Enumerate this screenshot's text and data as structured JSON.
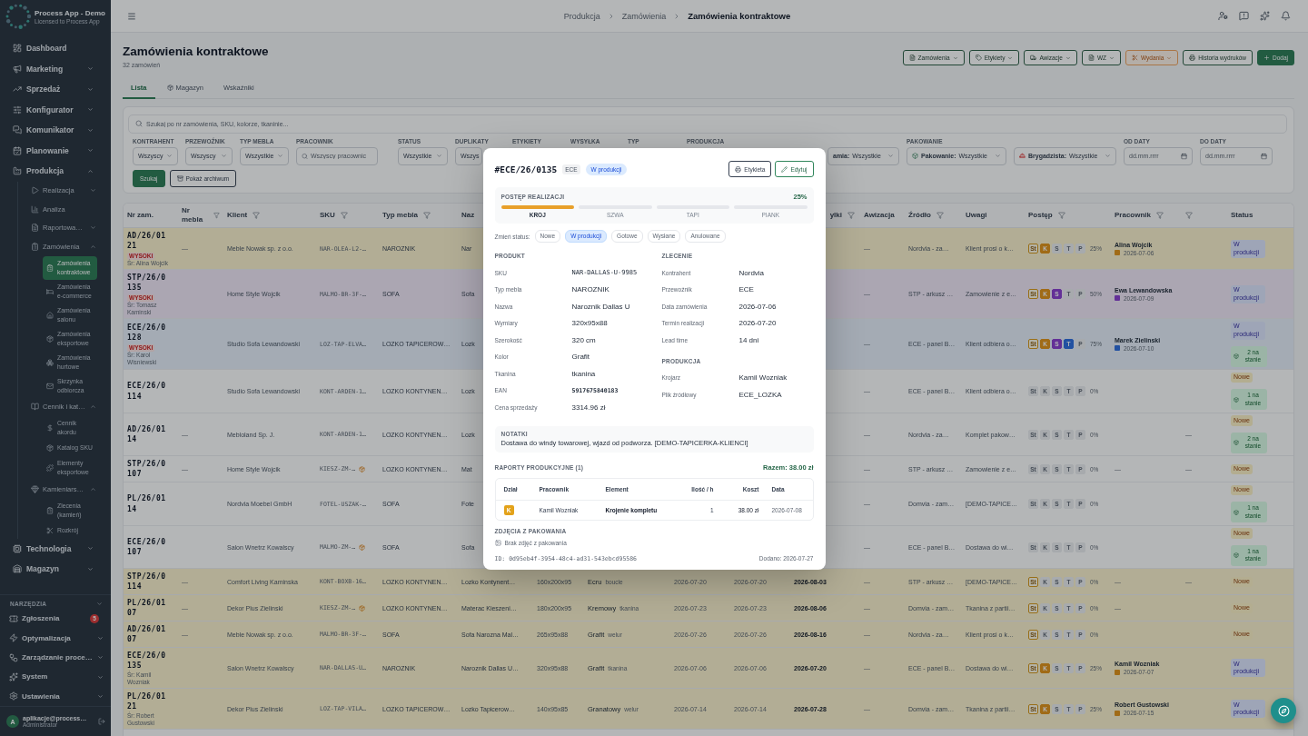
{
  "sidebar": {
    "app_name": "Process App - Demo",
    "app_subtitle": "Licensed to Process App",
    "items": [
      {
        "label": "Dashboard",
        "selected": false
      },
      {
        "label": "Marketing",
        "expanded": false
      },
      {
        "label": "Sprzedaż",
        "expanded": false
      },
      {
        "label": "Konfigurator",
        "expanded": false
      },
      {
        "label": "Komunikator",
        "expanded": false
      },
      {
        "label": "Planowanie",
        "expanded": false
      },
      {
        "label": "Produkcja",
        "expanded": true,
        "children": [
          {
            "label": "Realizacja",
            "expanded": false
          },
          {
            "label": "Analiza",
            "selected": false
          },
          {
            "label": "Raportowa…",
            "expanded": false
          },
          {
            "label": "Zamówienia",
            "expanded": true,
            "children": [
              {
                "label": "Zamówienia kontraktowe",
                "selected": true
              },
              {
                "label": "Zamówienia e-commerce",
                "selected": false
              },
              {
                "label": "Zamówienia salonu",
                "selected": false
              },
              {
                "label": "Zamówienia eksportowe",
                "selected": false
              },
              {
                "label": "Zamówienia hurtowe",
                "selected": false
              },
              {
                "label": "Skrzynka odbiorcza",
                "selected": false
              }
            ]
          },
          {
            "label": "Cennik i kat…",
            "expanded": true,
            "children": [
              {
                "label": "Cennik akordu",
                "selected": false
              },
              {
                "label": "Katalog SKU",
                "selected": false
              },
              {
                "label": "Elementy eksportowe",
                "selected": false
              }
            ]
          },
          {
            "label": "Kamieniars…",
            "expanded": true,
            "children": [
              {
                "label": "Zlecenia (kamień)",
                "selected": false
              },
              {
                "label": "Rozkrój",
                "selected": false
              }
            ]
          }
        ]
      },
      {
        "label": "Technologia",
        "expanded": false
      },
      {
        "label": "Magazyn",
        "expanded": false
      }
    ],
    "tools": {
      "label": "NARZĘDZIA",
      "expanded": true,
      "items": [
        {
          "label": "Zgłoszenia",
          "selected": false,
          "badge": "5"
        },
        {
          "label": "Optymalizacja",
          "expanded": false
        },
        {
          "label": "Zarządzanie proce…",
          "expanded": false
        },
        {
          "label": "System",
          "expanded": false
        },
        {
          "label": "Ustawienia",
          "expanded": false
        }
      ]
    },
    "user": {
      "initial": "A",
      "email": "aplikacje@process…",
      "role": "Administrator"
    }
  },
  "header": {
    "breadcrumb": [
      "Produkcja",
      "Zamówienia",
      "Zamówienia kontraktowe"
    ]
  },
  "page": {
    "title": "Zamówienia kontraktowe",
    "subtitle": "32 zamówień",
    "actions": [
      {
        "label": "Zamówienia",
        "kind": "outline",
        "menu": true
      },
      {
        "label": "Etykiety",
        "kind": "outline",
        "menu": true
      },
      {
        "label": "Awizacje",
        "kind": "outline",
        "menu": true
      },
      {
        "label": "WZ",
        "kind": "outline",
        "menu": true
      },
      {
        "label": "Wydania",
        "kind": "warning",
        "menu": true
      },
      {
        "label": "Historia wydruków",
        "kind": "outline"
      },
      {
        "label": "Dodaj",
        "kind": "primary"
      }
    ],
    "tabs": [
      {
        "label": "Lista",
        "selected": true
      },
      {
        "label": "Magazyn",
        "selected": false
      },
      {
        "label": "Wskaźniki",
        "selected": false
      }
    ]
  },
  "filters": {
    "search": {
      "placeholder": "Szukaj po nr zamówienia, SKU, kolorze, tkaninie..."
    },
    "fields": [
      {
        "label": "KONTRAHENT",
        "kind": "select",
        "value": "Wszyscy"
      },
      {
        "label": "PRZEWOŹNIK",
        "kind": "select",
        "value": "Wszyscy"
      },
      {
        "label": "TYP MEBLA",
        "kind": "select",
        "value": "Wszystkie"
      },
      {
        "label": "PRACOWNIK",
        "kind": "search",
        "placeholder": "Wszyscy pracownic"
      },
      {
        "label": "STATUS",
        "kind": "select",
        "value": "Wszystkie"
      },
      {
        "label": "DUPLIKATY",
        "kind": "select",
        "value": "Wszys"
      },
      {
        "label": "ETYKIETY",
        "kind": "covered"
      },
      {
        "label": "WYSYŁKA",
        "kind": "covered"
      },
      {
        "label": "TYP",
        "kind": "covered"
      },
      {
        "label": "PRODUKCJA",
        "kind": "covered"
      },
      {
        "kind": "select",
        "prefix": "amia:",
        "value": "Wszystkie"
      },
      {
        "label": "PAKOWANIE",
        "kind": "select",
        "prefix": "Pakowanie:",
        "value": "Wszystkie"
      },
      {
        "kind": "select",
        "prefix": "Brygadzista:",
        "value": "Wszystkie"
      },
      {
        "label": "OD DATY",
        "kind": "date",
        "placeholder": "dd.mm.rrrr"
      },
      {
        "label": "DO DATY",
        "kind": "date",
        "placeholder": "dd.mm.rrrr"
      }
    ],
    "buttons": [
      {
        "label": "Szukaj",
        "kind": "primary"
      },
      {
        "label": "Pokaż archiwum",
        "kind": "outline"
      }
    ]
  },
  "table": {
    "columns": [
      {
        "label": "Nr zam."
      },
      {
        "label": "Nr mebla",
        "filter": true
      },
      {
        "label": "Klient",
        "filter": true
      },
      {
        "label": "SKU",
        "filter": true
      },
      {
        "label": "Typ mebla",
        "filter": true
      },
      {
        "label": "Naz"
      },
      {
        "label": "ylki",
        "filter": true
      },
      {
        "label": "Awizacja"
      },
      {
        "label": "Źródło",
        "filter": true
      },
      {
        "label": "Uwagi"
      },
      {
        "label": "Postęp",
        "filter": true
      },
      {
        "label": "Pracownik",
        "filter": true
      },
      {
        "filter": true
      },
      {
        "label": "Status"
      }
    ],
    "rows": [
      {
        "nr": "AD/26/0121",
        "priority": "WYSOKI",
        "lead": "Śr: Alina Wojcik",
        "furniture_no": "—",
        "client": "Meble Nowak sp. z o.o.",
        "sku": "NAR-OLEA-L2-…",
        "type": "NAROZNIK",
        "column_6": "Nar",
        "awizacja": "—",
        "source": "Nordvia - za…",
        "notes": "Klient prosi o k…",
        "stages": [
          {
            "label": "St",
            "done": true
          },
          {
            "label": "K",
            "done": true
          },
          {
            "label": "S",
            "done": false
          },
          {
            "label": "T",
            "done": false
          },
          {
            "label": "P",
            "done": false
          }
        ],
        "percent": "25%",
        "worker": {
          "name": "Alina Wojcik",
          "date": "2026-07-06"
        },
        "status": {
          "label": "W produkcji",
          "kind": "production"
        }
      },
      {
        "nr": "STP/26/0135",
        "priority": "WYSOKI",
        "lead": "Śr: Tomasz Kaminski",
        "client": "Home Style Wojcik",
        "sku": "MALMO-BR-3F-…",
        "type": "SOFA",
        "column_6": "Sofa",
        "awizacja": "—",
        "source": "STP - arkusz …",
        "notes": "Zamowienie z e…",
        "stages": [
          {
            "label": "St",
            "done": true
          },
          {
            "label": "K",
            "done": true
          },
          {
            "label": "S",
            "done": true
          },
          {
            "label": "T",
            "done": false
          },
          {
            "label": "P",
            "done": false
          }
        ],
        "percent": "50%",
        "worker": {
          "name": "Ewa Lewandowska",
          "date": "2026-07-09"
        },
        "status": {
          "label": "W produkcji",
          "kind": "production"
        }
      },
      {
        "nr": "ECE/26/0128",
        "priority": "WYSOKI",
        "lead": "Śr: Karol Wisniewski",
        "client": "Studio Sofa Lewandowski",
        "sku": "LOZ-TAP-ELVA…",
        "type": "LOZKO TAPICEROW…",
        "column_6": "Lozk",
        "awizacja": "—",
        "source": "ECE - panel B…",
        "notes": "Klient odbiera o…",
        "stages": [
          {
            "label": "St",
            "done": true
          },
          {
            "label": "K",
            "done": true
          },
          {
            "label": "S",
            "done": true
          },
          {
            "label": "T",
            "done": true
          },
          {
            "label": "P",
            "done": false
          }
        ],
        "percent": "75%",
        "worker": {
          "name": "Marek Zielinski",
          "date": "2026-07-10"
        },
        "status": {
          "label": "W produkcji",
          "kind": "production"
        },
        "stock": "2 na stanie"
      },
      {
        "nr": "ECE/26/0114",
        "client": "Studio Sofa Lewandowski",
        "sku": "KONT-ARDEN-1…",
        "type": "LOZKO KONTYNEN…",
        "column_6": "Lozk",
        "awizacja": "—",
        "source": "ECE - panel B…",
        "notes": "Klient odbiera o…",
        "stages": [
          {
            "label": "St",
            "done": false
          },
          {
            "label": "K",
            "done": false
          },
          {
            "label": "S",
            "done": false
          },
          {
            "label": "T",
            "done": false
          },
          {
            "label": "P",
            "done": false
          }
        ],
        "percent": "0%",
        "status": {
          "label": "Nowe",
          "kind": "new"
        },
        "stock": "1 na stanie"
      },
      {
        "nr": "AD/26/0114",
        "furniture_no": "—",
        "client": "Mebloland Sp. J.",
        "sku": "KONT-ARDEN-1…",
        "type": "LOZKO KONTYNEN…",
        "column_6": "Lozk",
        "awizacja": "—",
        "source": "Nordvia - za…",
        "notes": "Komplet pakow…",
        "stages": [
          {
            "label": "St",
            "done": false
          },
          {
            "label": "K",
            "done": false
          },
          {
            "label": "S",
            "done": false
          },
          {
            "label": "T",
            "done": false
          },
          {
            "label": "P",
            "done": false
          }
        ],
        "percent": "0%",
        "column_17": "—",
        "status": {
          "label": "Nowe",
          "kind": "new"
        },
        "stock": "2 na stanie"
      },
      {
        "nr": "STP/26/0107",
        "furniture_no": "—",
        "client": "Home Style Wojcik",
        "sku": "KIESZ-ZM-…",
        "sku_flag": true,
        "type": "LOZKO KONTYNEN…",
        "column_6": "Mat",
        "awizacja": "—",
        "source": "STP - arkusz …",
        "notes": "Zamowienie z e…",
        "stages": [
          {
            "label": "St",
            "done": false
          },
          {
            "label": "K",
            "done": false
          },
          {
            "label": "S",
            "done": false
          },
          {
            "label": "T",
            "done": false
          },
          {
            "label": "P",
            "done": false
          }
        ],
        "percent": "0%",
        "worker_empty": "—",
        "column_17": "—",
        "status": {
          "label": "Nowe",
          "kind": "new"
        }
      },
      {
        "nr": "PL/26/0114",
        "client": "Nordvia Moebel GmbH",
        "sku": "FOTEL-USZAK-…",
        "type": "SOFA",
        "column_6": "Fote",
        "awizacja": "—",
        "source": "Domvia - zam…",
        "notes": "[DEMO-TAPICE…",
        "stages": [
          {
            "label": "St",
            "done": false
          },
          {
            "label": "K",
            "done": false
          },
          {
            "label": "S",
            "done": false
          },
          {
            "label": "T",
            "done": false
          },
          {
            "label": "P",
            "done": false
          }
        ],
        "percent": "0%",
        "status": {
          "label": "Nowe",
          "kind": "new"
        },
        "stock": "1 na stanie"
      },
      {
        "nr": "ECE/26/0107",
        "client": "Salon Wnetrz Kowalscy",
        "sku": "MALMO-ZM-…",
        "sku_flag": true,
        "type": "SOFA",
        "column_6": "Sofa",
        "awizacja": "—",
        "source": "ECE - panel B…",
        "notes": "Dostawa do wi…",
        "stages": [
          {
            "label": "St",
            "done": false
          },
          {
            "label": "K",
            "done": false
          },
          {
            "label": "S",
            "done": false
          },
          {
            "label": "T",
            "done": false
          },
          {
            "label": "P",
            "done": false
          }
        ],
        "percent": "0%",
        "status": {
          "label": "Nowe",
          "kind": "new"
        },
        "stock": "1 na stanie"
      },
      {
        "nr": "STP/26/0114",
        "furniture_no": "—",
        "client": "Comfort Living Kaminska",
        "sku": "KONT-BOXB-16…",
        "type": "LOZKO KONTYNEN…",
        "column_6": "Lozko Kontynent…",
        "column_7": "160x200x95",
        "column_8": {
          "text": "Ecru",
          "note": "boucle"
        },
        "column_9": "2026-07-20",
        "column_10": "2026-07-20",
        "column_11": "2026-08-03",
        "awizacja": "—",
        "source": "STP - arkusz …",
        "notes": "[DEMO-TAPICE…",
        "stages": [
          {
            "label": "St",
            "done": true
          },
          {
            "label": "K",
            "done": false
          },
          {
            "label": "S",
            "done": false
          },
          {
            "label": "T",
            "done": false
          },
          {
            "label": "P",
            "done": false
          }
        ],
        "percent": "0%",
        "worker_empty": "—",
        "column_17": "—",
        "status": {
          "label": "Nowe",
          "kind": "new"
        }
      },
      {
        "nr": "PL/26/0107",
        "furniture_no": "—",
        "client": "Dekor Plus Zielinski",
        "sku": "KIESZ-ZM-…",
        "sku_flag": true,
        "type": "LOZKO KONTYNEN…",
        "column_6": "Materac Kieszeni…",
        "column_7": "180x200x95",
        "column_8": {
          "text": "Kremowy",
          "note": "tkanina"
        },
        "column_9": "2026-07-23",
        "column_10": "2026-07-23",
        "column_11": "2026-08-06",
        "awizacja": "—",
        "source": "Domvia - zam…",
        "notes": "Tkanina z partii…",
        "stages": [
          {
            "label": "St",
            "done": true
          },
          {
            "label": "K",
            "done": false
          },
          {
            "label": "S",
            "done": false
          },
          {
            "label": "T",
            "done": false
          },
          {
            "label": "P",
            "done": false
          }
        ],
        "percent": "0%",
        "worker_empty": "—",
        "status": {
          "label": "Nowe",
          "kind": "new"
        }
      },
      {
        "nr": "AD/26/0107",
        "furniture_no": "—",
        "client": "Meble Nowak sp. z o.o.",
        "sku": "MALMO-BR-3F-…",
        "type": "SOFA",
        "column_6": "Sofa Narozna Mal…",
        "column_7": "265x95x88",
        "column_8": {
          "text": "Grafit",
          "note": "welur"
        },
        "column_9": "2026-07-26",
        "column_10": "2026-07-26",
        "column_11": "2026-08-16",
        "awizacja": "—",
        "source": "Nordvia - za…",
        "notes": "Klient prosi o k…",
        "stages": [
          {
            "label": "St",
            "done": true
          },
          {
            "label": "K",
            "done": false
          },
          {
            "label": "S",
            "done": false
          },
          {
            "label": "T",
            "done": false
          },
          {
            "label": "P",
            "done": false
          }
        ],
        "percent": "0%",
        "status": {
          "label": "Nowe",
          "kind": "new"
        }
      },
      {
        "nr": "ECE/26/0135",
        "lead": "Śr: Kamil Wozniak",
        "client": "Salon Wnetrz Kowalscy",
        "sku": "NAR-DALLAS-U…",
        "type": "NAROZNIK",
        "column_6": "Naroznik Dallas U…",
        "column_7": "320x95x88",
        "column_8": {
          "text": "Grafit",
          "note": "tkanina"
        },
        "column_9": "2026-07-06",
        "column_10": "2026-07-06",
        "column_11": "2026-07-20",
        "awizacja": "—",
        "source": "ECE - panel B…",
        "notes": "Dostawa do wi…",
        "stages": [
          {
            "label": "St",
            "done": true
          },
          {
            "label": "K",
            "done": true
          },
          {
            "label": "S",
            "done": false
          },
          {
            "label": "T",
            "done": false
          },
          {
            "label": "P",
            "done": false
          }
        ],
        "percent": "25%",
        "worker": {
          "name": "Kamil Wozniak",
          "date": "2026-07-07"
        },
        "status": {
          "label": "W produkcji",
          "kind": "production"
        }
      },
      {
        "nr": "PL/26/0121",
        "lead": "Śr: Robert Gustowski",
        "client": "Dekor Plus Zielinski",
        "sku": "LOZ-TAP-VILA…",
        "type": "LOZKO TAPICEROW…",
        "column_6": "Lozko Tapicerow…",
        "column_7": "140x95x85",
        "column_8": {
          "text": "Granatowy",
          "note": "welur"
        },
        "column_9": "2026-07-14",
        "column_10": "2026-07-14",
        "column_11": "2026-07-28",
        "awizacja": "—",
        "source": "Domvia - zam…",
        "notes": "Tkanina z partii…",
        "stages": [
          {
            "label": "St",
            "done": true
          },
          {
            "label": "K",
            "done": true
          },
          {
            "label": "S",
            "done": false
          },
          {
            "label": "T",
            "done": false
          },
          {
            "label": "P",
            "done": false
          }
        ],
        "percent": "25%",
        "worker": {
          "name": "Robert Gustowski",
          "date": "2026-07-15"
        },
        "status": {
          "label": "W produkcji",
          "kind": "production"
        }
      }
    ]
  },
  "modal": {
    "order_no": "#ECE/26/0135",
    "carrier": "ECE",
    "status": "W produkcji",
    "buttons": [
      {
        "label": "Etykieta",
        "kind": "outline"
      },
      {
        "label": "Edytuj",
        "kind": "success"
      }
    ],
    "progress": {
      "title": "POSTĘP REALIZACJI",
      "percent": "25%",
      "stages": [
        {
          "label": "KROJ",
          "done": true
        },
        {
          "label": "SZWA",
          "done": false
        },
        {
          "label": "TAPI",
          "done": false
        },
        {
          "label": "PIANK",
          "done": false
        }
      ]
    },
    "status_change": {
      "label": "Zmień status:",
      "options": [
        {
          "label": "Nowe",
          "selected": false
        },
        {
          "label": "W produkcji",
          "selected": true
        },
        {
          "label": "Gotowe",
          "selected": false
        },
        {
          "label": "Wysłane",
          "selected": false
        },
        {
          "label": "Anulowane",
          "selected": false
        }
      ]
    },
    "product": {
      "title": "PRODUKT",
      "fields": [
        {
          "label": "SKU",
          "value": "NAR-DALLAS-U-9985",
          "kind": "mono"
        },
        {
          "label": "Typ mebla",
          "value": "NAROZNIK",
          "kind": "text"
        },
        {
          "label": "Nazwa",
          "value": "Naroznik Dallas U",
          "kind": "text"
        },
        {
          "label": "Wymiary",
          "value": "320x95x88",
          "kind": "text"
        },
        {
          "label": "Szerokość",
          "value": "320 cm",
          "kind": "text"
        },
        {
          "label": "Kolor",
          "value": "Grafit",
          "kind": "text"
        },
        {
          "label": "Tkanina",
          "value": "tkanina",
          "kind": "text"
        },
        {
          "label": "EAN",
          "value": "5917675840183",
          "kind": "code"
        },
        {
          "label": "Cena sprzedaży",
          "value": "3314.96 zł",
          "kind": "text"
        }
      ]
    },
    "order": {
      "title": "ZLECENIE",
      "fields": [
        {
          "label": "Kontrahent",
          "value": "Nordvia",
          "kind": "text"
        },
        {
          "label": "Przewoźnik",
          "value": "ECE",
          "kind": "text"
        },
        {
          "label": "Data zamówienia",
          "value": "2026-07-06",
          "kind": "text"
        },
        {
          "label": "Termin realizacji",
          "value": "2026-07-20",
          "kind": "text"
        },
        {
          "label": "Lead time",
          "value": "14 dni",
          "kind": "text"
        }
      ]
    },
    "production": {
      "title": "PRODUKCJA",
      "fields": [
        {
          "label": "Krojarz",
          "value": "Kamil Wozniak",
          "kind": "text"
        },
        {
          "label": "Plik źródłowy",
          "value": "ECE_LOZKA",
          "kind": "text"
        }
      ]
    },
    "notes": {
      "title": "NOTATKI",
      "text": "Dostawa do windy towarowej, wjazd od podworza. [DEMO-TAPICERKA-KLIENCI]"
    },
    "reports": {
      "title": "RAPORTY PRODUKCYJNE (1)",
      "total": "Razem: 38.00 zł",
      "columns": [
        "Dział",
        "Pracownik",
        "Element",
        "Ilość / h",
        "Koszt",
        "Data"
      ],
      "rows": [
        {
          "dept": "K",
          "color": "#e3a21a",
          "worker": "Kamil Wozniak",
          "element": "Krojenie kompletu",
          "qty": "1",
          "cost": "38.00 zł",
          "date": "2026-07-08"
        }
      ]
    },
    "photos": {
      "title": "ZDJĘCIA Z PAKOWANIA",
      "empty": "Brak zdjęć z pakowania"
    },
    "footer": {
      "id": "ID: 0d95eb4f-3954-48c4-ad31-543ebcd95586",
      "added": "Dodano: 2026-07-27"
    }
  }
}
